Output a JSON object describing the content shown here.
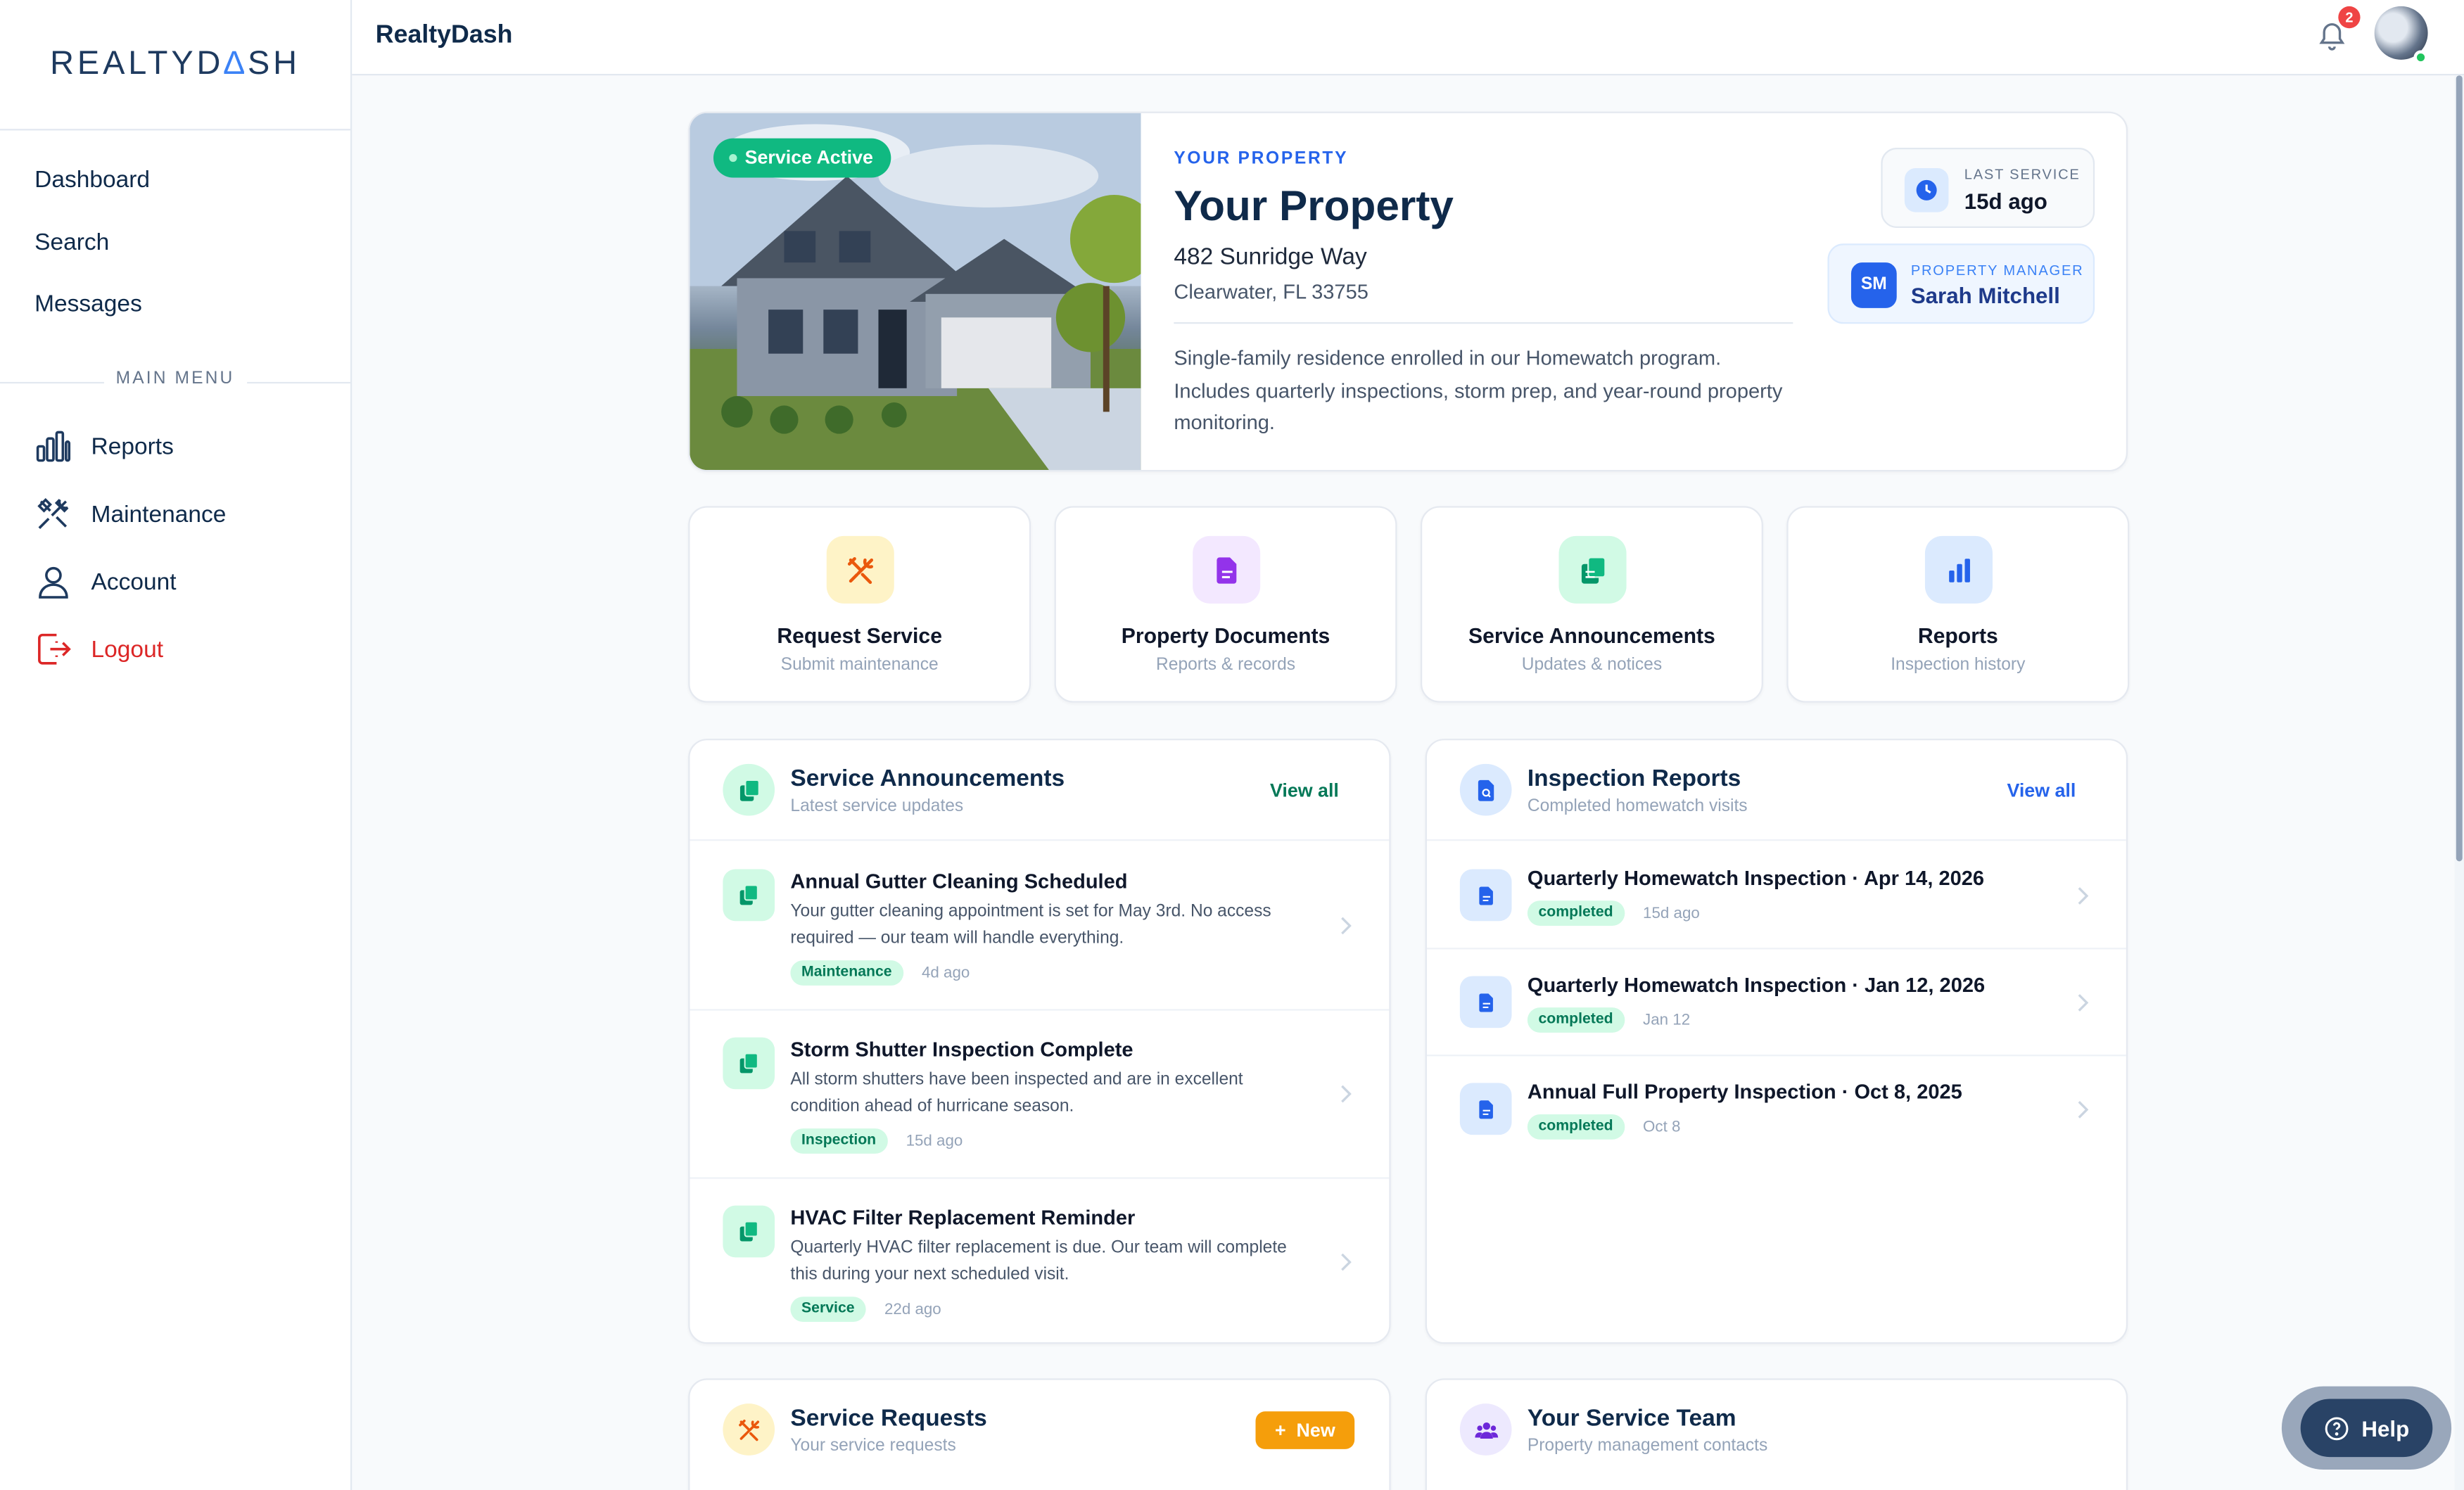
{
  "app": {
    "logo_left": "REALTYD",
    "logo_accent": "∆",
    "logo_right": "SH",
    "brand_title": "RealtyDash"
  },
  "sidebar": {
    "top_links": [
      "Dashboard",
      "Search",
      "Messages"
    ],
    "menu_label": "MAIN MENU",
    "items": [
      {
        "label": "Reports",
        "icon": "bar-chart-icon"
      },
      {
        "label": "Maintenance",
        "icon": "tools-icon"
      },
      {
        "label": "Account",
        "icon": "user-icon"
      },
      {
        "label": "Logout",
        "icon": "logout-icon"
      }
    ]
  },
  "topbar": {
    "notification_count": "2"
  },
  "property": {
    "status_badge": "Service Active",
    "eyebrow": "YOUR PROPERTY",
    "title": "Your Property",
    "address": "482 Sunridge Way",
    "city": "Clearwater, FL 33755",
    "description": "Single-family residence enrolled in our Homewatch program. Includes quarterly inspections, storm prep, and year-round property monitoring.",
    "last_service_label": "LAST SERVICE",
    "last_service_value": "15d ago",
    "manager_initials": "SM",
    "manager_label": "PROPERTY MANAGER",
    "manager_name": "Sarah Mitchell"
  },
  "quick_actions": [
    {
      "title": "Request Service",
      "subtitle": "Submit maintenance",
      "icon": "tools-icon",
      "color": "#ea580c",
      "bg": "#fef3c7"
    },
    {
      "title": "Property Documents",
      "subtitle": "Reports & records",
      "icon": "document-icon",
      "color": "#9333ea",
      "bg": "#f3e8ff"
    },
    {
      "title": "Service Announcements",
      "subtitle": "Updates & notices",
      "icon": "copy-icon",
      "color": "#059669",
      "bg": "#d1fae5"
    },
    {
      "title": "Reports",
      "subtitle": "Inspection history",
      "icon": "bar-chart-icon",
      "color": "#2563eb",
      "bg": "#dbeafe"
    }
  ],
  "announcements": {
    "title": "Service Announcements",
    "subtitle": "Latest service updates",
    "view_all": "View all",
    "items": [
      {
        "title": "Annual Gutter Cleaning Scheduled",
        "body": "Your gutter cleaning appointment is set for May 3rd. No access required — our team will handle everything.",
        "tag": "Maintenance",
        "ago": "4d ago"
      },
      {
        "title": "Storm Shutter Inspection Complete",
        "body": "All storm shutters have been inspected and are in excellent condition ahead of hurricane season.",
        "tag": "Inspection",
        "ago": "15d ago"
      },
      {
        "title": "HVAC Filter Replacement Reminder",
        "body": "Quarterly HVAC filter replacement is due. Our team will complete this during your next scheduled visit.",
        "tag": "Service",
        "ago": "22d ago"
      }
    ]
  },
  "reports": {
    "title": "Inspection Reports",
    "subtitle": "Completed homewatch visits",
    "view_all": "View all",
    "items": [
      {
        "title": "Quarterly Homewatch Inspection · Apr 14, 2026",
        "status": "completed",
        "date": "15d ago"
      },
      {
        "title": "Quarterly Homewatch Inspection · Jan 12, 2026",
        "status": "completed",
        "date": "Jan 12"
      },
      {
        "title": "Annual Full Property Inspection · Oct 8, 2025",
        "status": "completed",
        "date": "Oct 8"
      }
    ]
  },
  "service_requests": {
    "title": "Service Requests",
    "subtitle": "Your service requests",
    "new_button": "New"
  },
  "service_team": {
    "title": "Your Service Team",
    "subtitle": "Property management contacts"
  },
  "help": {
    "label": "Help"
  },
  "colors": {
    "brand_navy": "#0f2a4a",
    "accent_blue": "#2563eb",
    "success_green": "#10b981",
    "logout_red": "#dc2626",
    "warning_orange": "#f59e0b"
  }
}
